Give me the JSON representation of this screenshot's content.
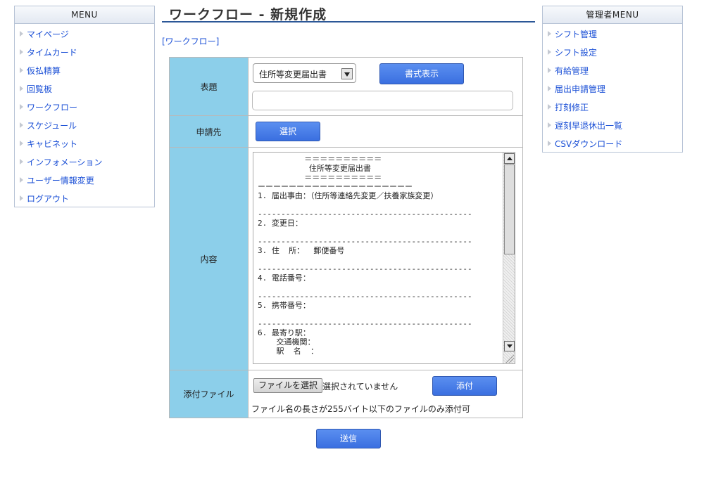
{
  "left_menu": {
    "title": "MENU",
    "items": [
      "マイページ",
      "タイムカード",
      "仮払精算",
      "回覧板",
      "ワークフロー",
      "スケジュール",
      "キャビネット",
      "インフォメーション",
      "ユーザー情報変更",
      "ログアウト"
    ]
  },
  "admin_menu": {
    "title": "管理者MENU",
    "items": [
      "シフト管理",
      "シフト設定",
      "有給管理",
      "届出申請管理",
      "打刻修正",
      "遅刻早退休出一覧",
      "CSVダウンロード"
    ]
  },
  "page": {
    "title": "ワークフロー - 新規作成",
    "breadcrumb": "[ワークフロー]"
  },
  "form": {
    "subject_label": "表題",
    "template_select": "住所等変更届出書",
    "show_format_button": "書式表示",
    "subject_value": "",
    "recipient_label": "申請先",
    "select_button": "選択",
    "content_label": "内容",
    "content_lines": [
      "          ＝＝＝＝＝＝＝＝＝＝",
      "           住所等変更届出書",
      "          ＝＝＝＝＝＝＝＝＝＝",
      "ーーーーーーーーーーーーーーーーーーーー",
      "1. 届出事由：（住所等連絡先変更／扶養家族変更）",
      "",
      "----------------------------------------------",
      "2. 変更日：",
      "",
      "----------------------------------------------",
      "3. 住  所：  郵便番号",
      "",
      "----------------------------------------------",
      "4. 電話番号：",
      "",
      "----------------------------------------------",
      "5. 携帯番号：",
      "",
      "----------------------------------------------",
      "6. 最寄り駅：",
      "    交通機関：",
      "    駅  名  ："
    ],
    "attachment_label": "添付ファイル",
    "file_choose_button": "ファイルを選択",
    "file_status": "選択されていません",
    "attach_button": "添付",
    "file_note": "ファイル名の長さが255バイト以下のファイルのみ添付可"
  },
  "submit_button": "送信"
}
